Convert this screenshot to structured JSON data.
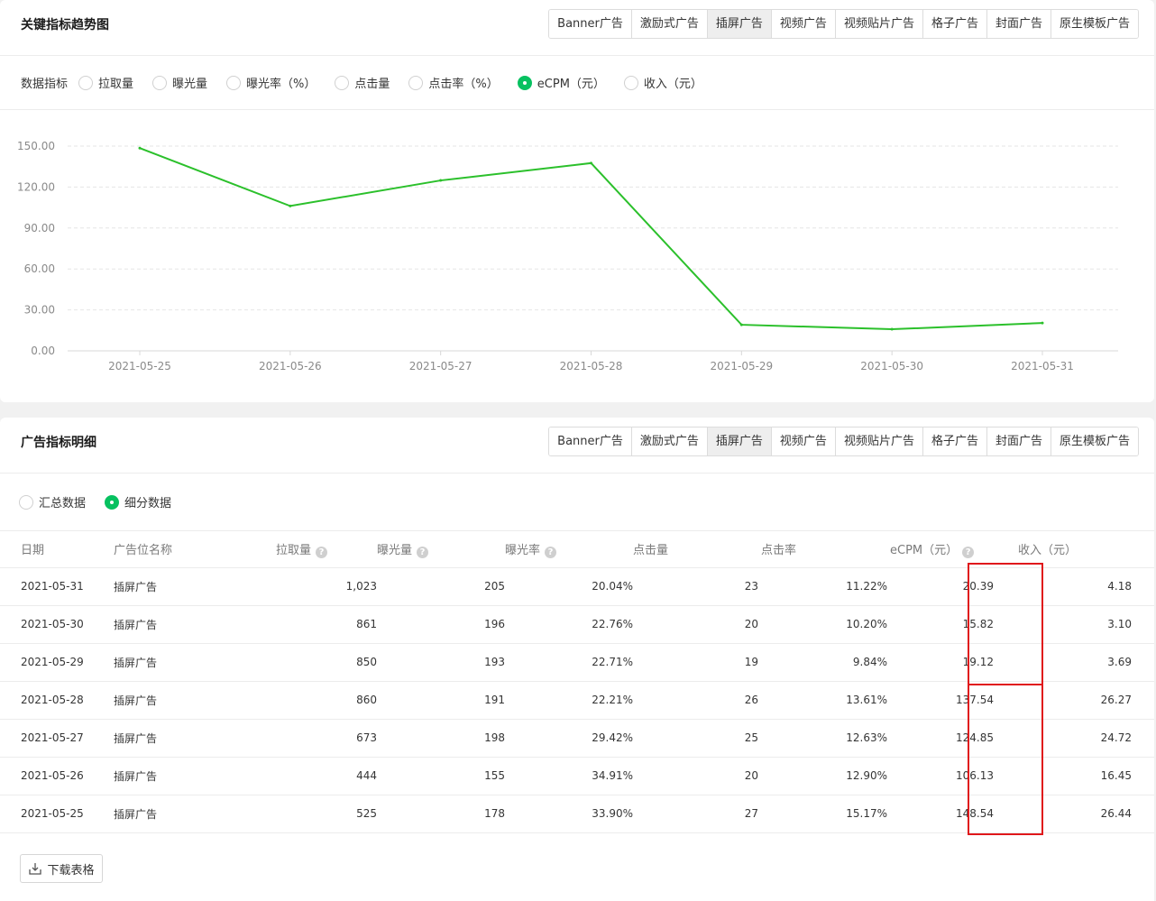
{
  "ad_tabs": [
    "Banner广告",
    "激励式广告",
    "插屏广告",
    "视频广告",
    "视频贴片广告",
    "格子广告",
    "封面广告",
    "原生模板广告"
  ],
  "active_tab_index": 2,
  "trend": {
    "title": "关键指标趋势图",
    "metrics_label": "数据指标",
    "metrics": [
      "拉取量",
      "曝光量",
      "曝光率（%）",
      "点击量",
      "点击率（%）",
      "eCPM（元）",
      "收入（元）"
    ],
    "selected_metric_index": 5
  },
  "chart_data": {
    "type": "line",
    "x": [
      "2021-05-25",
      "2021-05-26",
      "2021-05-27",
      "2021-05-28",
      "2021-05-29",
      "2021-05-30",
      "2021-05-31"
    ],
    "series": [
      {
        "values": [
          148.54,
          106.13,
          124.85,
          137.54,
          19.12,
          15.82,
          20.39
        ],
        "color": "#2bc02b"
      }
    ],
    "ylim": [
      0,
      150
    ],
    "yticks": [
      "150.00",
      "120.00",
      "90.00",
      "60.00",
      "30.00",
      "0.00"
    ],
    "grid": true
  },
  "detail": {
    "title": "广告指标明细",
    "view_options": [
      "汇总数据",
      "细分数据"
    ],
    "selected_view_index": 1,
    "columns": [
      "日期",
      "广告位名称",
      "拉取量",
      "曝光量",
      "曝光率",
      "点击量",
      "点击率",
      "eCPM（元）",
      "收入（元）"
    ],
    "rows": [
      [
        "2021-05-31",
        "插屏广告",
        "1,023",
        "205",
        "20.04%",
        "23",
        "11.22%",
        "20.39",
        "4.18"
      ],
      [
        "2021-05-30",
        "插屏广告",
        "861",
        "196",
        "22.76%",
        "20",
        "10.20%",
        "15.82",
        "3.10"
      ],
      [
        "2021-05-29",
        "插屏广告",
        "850",
        "193",
        "22.71%",
        "19",
        "9.84%",
        "19.12",
        "3.69"
      ],
      [
        "2021-05-28",
        "插屏广告",
        "860",
        "191",
        "22.21%",
        "26",
        "13.61%",
        "137.54",
        "26.27"
      ],
      [
        "2021-05-27",
        "插屏广告",
        "673",
        "198",
        "29.42%",
        "25",
        "12.63%",
        "124.85",
        "24.72"
      ],
      [
        "2021-05-26",
        "插屏广告",
        "444",
        "155",
        "34.91%",
        "20",
        "12.90%",
        "106.13",
        "16.45"
      ],
      [
        "2021-05-25",
        "插屏广告",
        "525",
        "178",
        "33.90%",
        "27",
        "15.17%",
        "148.54",
        "26.44"
      ]
    ],
    "download_label": "下载表格"
  },
  "colors": {
    "accent": "#07c160",
    "line": "#2bc02b",
    "highlight": "#e0181b"
  }
}
